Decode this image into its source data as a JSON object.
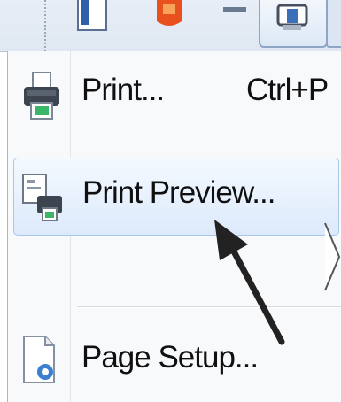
{
  "menu": {
    "items": [
      {
        "label": "Print...",
        "shortcut": "Ctrl+P",
        "icon": "printer-icon"
      },
      {
        "label": "Print Preview...",
        "icon": "print-preview-icon",
        "highlighted": true
      },
      {
        "label": "Page Setup...",
        "icon": "page-setup-icon"
      }
    ]
  },
  "toolbar": {
    "icons": [
      "page-icon",
      "office-icon",
      "print-icon"
    ]
  },
  "colors": {
    "highlight_border": "#a9c6ea",
    "highlight_fill": "#dceafb",
    "menu_bg": "#f8f9fb"
  }
}
